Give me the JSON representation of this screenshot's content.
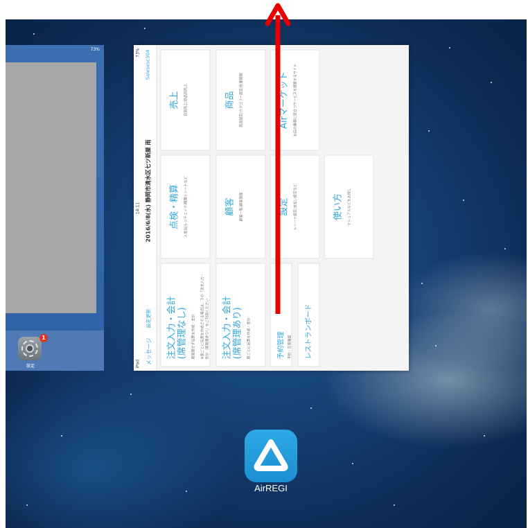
{
  "left_card": {
    "status": "73%",
    "settings_label": "設定",
    "settings_badge": "1"
  },
  "airregi_card": {
    "status_left": "iPad",
    "status_time": "14:11",
    "status_right": "73%",
    "nav": {
      "message": "メッセージ",
      "update": "設定更新",
      "title": "2016/6/8(水) 静岡市清水区七ツ新屋 雨",
      "store": "Salesesc304"
    },
    "tiles": {
      "order_no_seat": {
        "title": "注文入力・会計\n(席管理なし)",
        "desc": "席管理せず伝票を作成・会計",
        "note": "※席ごとに伝票を作成される場合は、下の「注文入力・会計（席管理あり）」をご利用ください"
      },
      "order_seat": {
        "title": "注文入力・会計\n(席管理あり)",
        "desc": "席ごとに伝票を作成・会計"
      },
      "reservation": {
        "title": "予約管理",
        "desc": "予約・空席確認"
      },
      "restaurant_board": {
        "title": "レストランボード"
      },
      "check": {
        "title": "点検・精算",
        "desc": "入金出/レジチェック/精算レシートなど"
      },
      "customers": {
        "title": "顧客",
        "desc": "顧客一覧/顧客登録"
      },
      "settings": {
        "title": "設定",
        "desc": "レシート設定/支払い設定など"
      },
      "help": {
        "title": "使い方",
        "desc": "マニュアルなどをお探し"
      },
      "sales": {
        "title": "売上",
        "desc": "日別売上/商品別売上"
      },
      "products": {
        "title": "商品",
        "desc": "商品設定/カテゴリー設定/在庫管理"
      },
      "market": {
        "title": "Airマーケット",
        "desc": "お店の業務に役立つサービスを提案するサイト"
      }
    }
  },
  "home_icon": {
    "label": "AirREGI"
  },
  "colors": {
    "accent": "#35a7d8",
    "arrow": "#e60000",
    "icon_bg": "#1c8fd0"
  }
}
